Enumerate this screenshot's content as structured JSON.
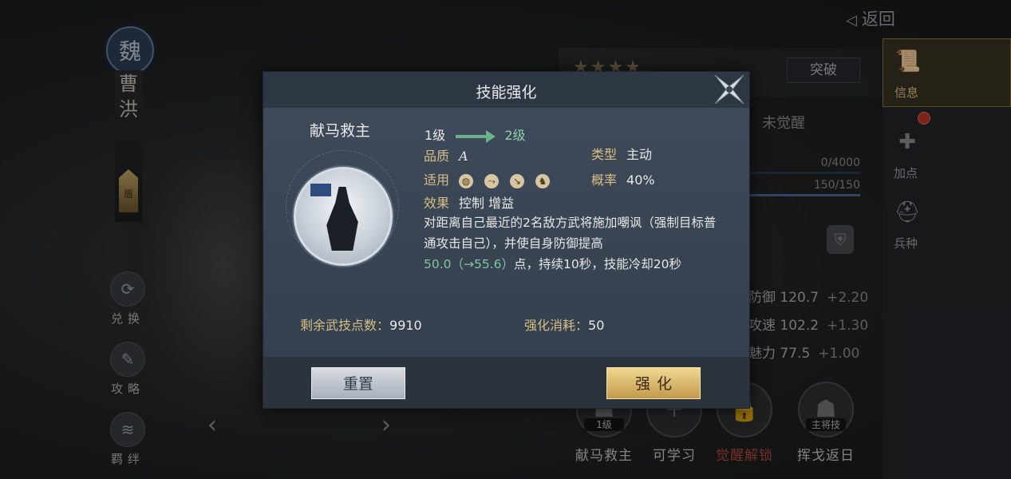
{
  "background": {
    "faction_emblem": "魏",
    "hero_name_chars": [
      "曹",
      "洪"
    ],
    "hero_role_badge": "盾",
    "back_label": "返回",
    "stars_count": 4,
    "break_label": "突破",
    "unawakened_label": "未觉醒",
    "exp_text": "0/4000",
    "stamina_text": "150/150",
    "stats": [
      {
        "name": "防御",
        "value": "120.7",
        "plus": "+2.20"
      },
      {
        "name": "攻速",
        "value": "102.2",
        "plus": "+1.30"
      },
      {
        "name": "魅力",
        "value": "77.5",
        "plus": "+1.00"
      }
    ]
  },
  "left_menu": [
    {
      "label": "兑换",
      "icon": "exchange-icon"
    },
    {
      "label": "攻略",
      "icon": "guide-icon"
    },
    {
      "label": "羁绊",
      "icon": "bond-icon"
    }
  ],
  "right_tabs": [
    {
      "label": "信息",
      "icon": "scroll-icon",
      "active": true
    },
    {
      "label": "加点",
      "icon": "points-icon",
      "active": false,
      "badge": true
    },
    {
      "label": "兵种",
      "icon": "troop-icon",
      "active": false
    }
  ],
  "bottom_skills": [
    {
      "label": "献马救主",
      "tag": "1级",
      "icon": "skill-portrait-icon"
    },
    {
      "label": "可学习",
      "tag": "",
      "icon": "plus-icon"
    },
    {
      "label": "觉醒解锁",
      "tag": "",
      "icon": "lock-icon",
      "locked": true
    },
    {
      "label": "挥戈返日",
      "tag": "主将技",
      "icon": "skill-portrait-icon"
    }
  ],
  "dialog": {
    "title": "技能强化",
    "skill_name": "献马救主",
    "level_from": "1级",
    "level_to": "2级",
    "quality_label": "品质",
    "quality_value": "A",
    "type_label": "类型",
    "type_value": "主动",
    "applicable_label": "适用",
    "applicable_weapons": [
      "shield-icon",
      "bow-icon",
      "spear-icon",
      "horse-icon"
    ],
    "chance_label": "概率",
    "chance_value": "40%",
    "effect_label": "效果",
    "effect_value": "控制 增益",
    "desc_line1": "对距离自己最近的2名敌方武将施加嘲讽（强制目标普通攻击自己），并使自身防御提高",
    "desc_bonus": "50.0（→55.6）",
    "desc_line2": "点，持续10秒，技能冷却20秒",
    "remaining_label": "剩余武技点数：",
    "remaining_value": "9910",
    "cost_label": "强化消耗：",
    "cost_value": "50",
    "reset_label": "重置",
    "enhance_label": "强化"
  }
}
